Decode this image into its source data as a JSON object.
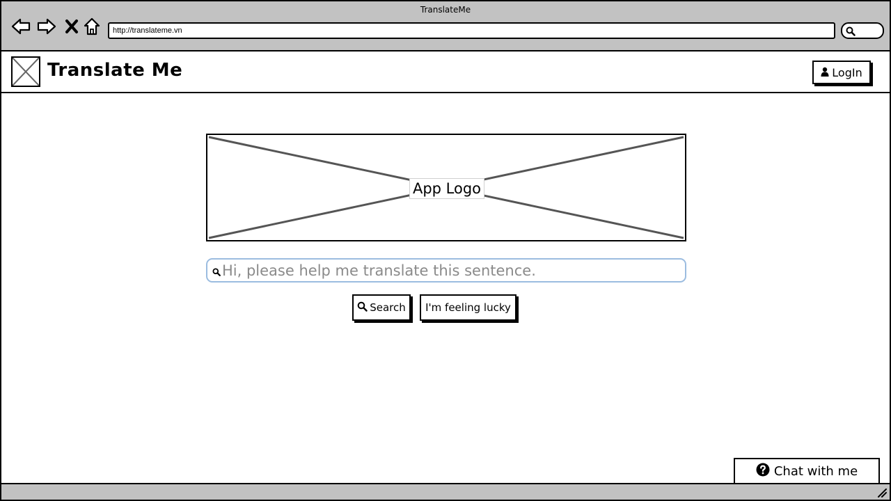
{
  "browser": {
    "window_title": "TranslateMe",
    "address_url": "http://translateme.vn",
    "nav_icons": [
      "back-icon",
      "forward-icon",
      "stop-icon",
      "home-icon"
    ]
  },
  "header": {
    "brand_title": "Translate Me",
    "login_label": "LogIn"
  },
  "main": {
    "logo_label": "App Logo",
    "search_placeholder": "Hi, please help me translate this sentence.",
    "search_value": "",
    "search_button_label": "Search",
    "lucky_button_label": "I'm feeling lucky"
  },
  "chat": {
    "label": "Chat with me"
  },
  "colors": {
    "chrome": "#c2c2c2",
    "search_border": "#9bbce0",
    "placeholder": "#8a8a8a"
  }
}
